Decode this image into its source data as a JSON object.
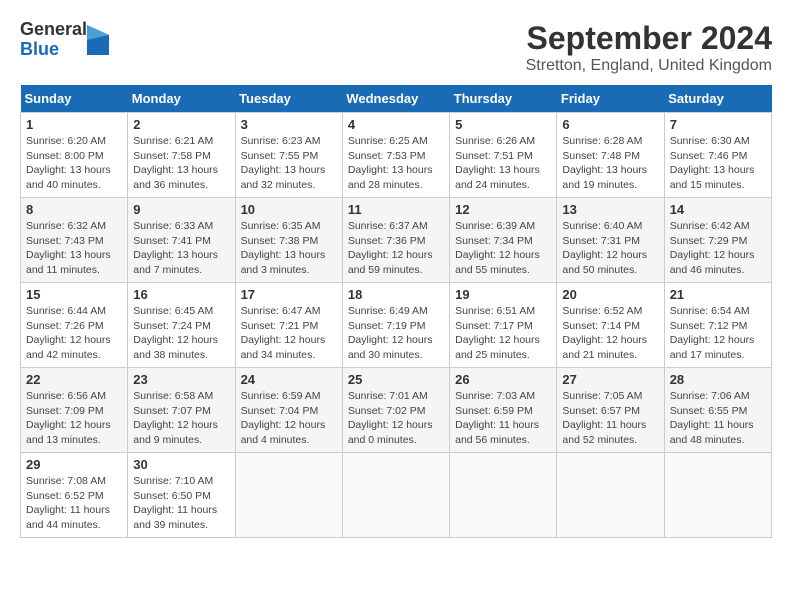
{
  "header": {
    "logo_general": "General",
    "logo_blue": "Blue",
    "month_title": "September 2024",
    "location": "Stretton, England, United Kingdom"
  },
  "weekdays": [
    "Sunday",
    "Monday",
    "Tuesday",
    "Wednesday",
    "Thursday",
    "Friday",
    "Saturday"
  ],
  "weeks": [
    [
      {
        "day": "1",
        "info": "Sunrise: 6:20 AM\nSunset: 8:00 PM\nDaylight: 13 hours and 40 minutes."
      },
      {
        "day": "2",
        "info": "Sunrise: 6:21 AM\nSunset: 7:58 PM\nDaylight: 13 hours and 36 minutes."
      },
      {
        "day": "3",
        "info": "Sunrise: 6:23 AM\nSunset: 7:55 PM\nDaylight: 13 hours and 32 minutes."
      },
      {
        "day": "4",
        "info": "Sunrise: 6:25 AM\nSunset: 7:53 PM\nDaylight: 13 hours and 28 minutes."
      },
      {
        "day": "5",
        "info": "Sunrise: 6:26 AM\nSunset: 7:51 PM\nDaylight: 13 hours and 24 minutes."
      },
      {
        "day": "6",
        "info": "Sunrise: 6:28 AM\nSunset: 7:48 PM\nDaylight: 13 hours and 19 minutes."
      },
      {
        "day": "7",
        "info": "Sunrise: 6:30 AM\nSunset: 7:46 PM\nDaylight: 13 hours and 15 minutes."
      }
    ],
    [
      {
        "day": "8",
        "info": "Sunrise: 6:32 AM\nSunset: 7:43 PM\nDaylight: 13 hours and 11 minutes."
      },
      {
        "day": "9",
        "info": "Sunrise: 6:33 AM\nSunset: 7:41 PM\nDaylight: 13 hours and 7 minutes."
      },
      {
        "day": "10",
        "info": "Sunrise: 6:35 AM\nSunset: 7:38 PM\nDaylight: 13 hours and 3 minutes."
      },
      {
        "day": "11",
        "info": "Sunrise: 6:37 AM\nSunset: 7:36 PM\nDaylight: 12 hours and 59 minutes."
      },
      {
        "day": "12",
        "info": "Sunrise: 6:39 AM\nSunset: 7:34 PM\nDaylight: 12 hours and 55 minutes."
      },
      {
        "day": "13",
        "info": "Sunrise: 6:40 AM\nSunset: 7:31 PM\nDaylight: 12 hours and 50 minutes."
      },
      {
        "day": "14",
        "info": "Sunrise: 6:42 AM\nSunset: 7:29 PM\nDaylight: 12 hours and 46 minutes."
      }
    ],
    [
      {
        "day": "15",
        "info": "Sunrise: 6:44 AM\nSunset: 7:26 PM\nDaylight: 12 hours and 42 minutes."
      },
      {
        "day": "16",
        "info": "Sunrise: 6:45 AM\nSunset: 7:24 PM\nDaylight: 12 hours and 38 minutes."
      },
      {
        "day": "17",
        "info": "Sunrise: 6:47 AM\nSunset: 7:21 PM\nDaylight: 12 hours and 34 minutes."
      },
      {
        "day": "18",
        "info": "Sunrise: 6:49 AM\nSunset: 7:19 PM\nDaylight: 12 hours and 30 minutes."
      },
      {
        "day": "19",
        "info": "Sunrise: 6:51 AM\nSunset: 7:17 PM\nDaylight: 12 hours and 25 minutes."
      },
      {
        "day": "20",
        "info": "Sunrise: 6:52 AM\nSunset: 7:14 PM\nDaylight: 12 hours and 21 minutes."
      },
      {
        "day": "21",
        "info": "Sunrise: 6:54 AM\nSunset: 7:12 PM\nDaylight: 12 hours and 17 minutes."
      }
    ],
    [
      {
        "day": "22",
        "info": "Sunrise: 6:56 AM\nSunset: 7:09 PM\nDaylight: 12 hours and 13 minutes."
      },
      {
        "day": "23",
        "info": "Sunrise: 6:58 AM\nSunset: 7:07 PM\nDaylight: 12 hours and 9 minutes."
      },
      {
        "day": "24",
        "info": "Sunrise: 6:59 AM\nSunset: 7:04 PM\nDaylight: 12 hours and 4 minutes."
      },
      {
        "day": "25",
        "info": "Sunrise: 7:01 AM\nSunset: 7:02 PM\nDaylight: 12 hours and 0 minutes."
      },
      {
        "day": "26",
        "info": "Sunrise: 7:03 AM\nSunset: 6:59 PM\nDaylight: 11 hours and 56 minutes."
      },
      {
        "day": "27",
        "info": "Sunrise: 7:05 AM\nSunset: 6:57 PM\nDaylight: 11 hours and 52 minutes."
      },
      {
        "day": "28",
        "info": "Sunrise: 7:06 AM\nSunset: 6:55 PM\nDaylight: 11 hours and 48 minutes."
      }
    ],
    [
      {
        "day": "29",
        "info": "Sunrise: 7:08 AM\nSunset: 6:52 PM\nDaylight: 11 hours and 44 minutes."
      },
      {
        "day": "30",
        "info": "Sunrise: 7:10 AM\nSunset: 6:50 PM\nDaylight: 11 hours and 39 minutes."
      },
      null,
      null,
      null,
      null,
      null
    ]
  ]
}
